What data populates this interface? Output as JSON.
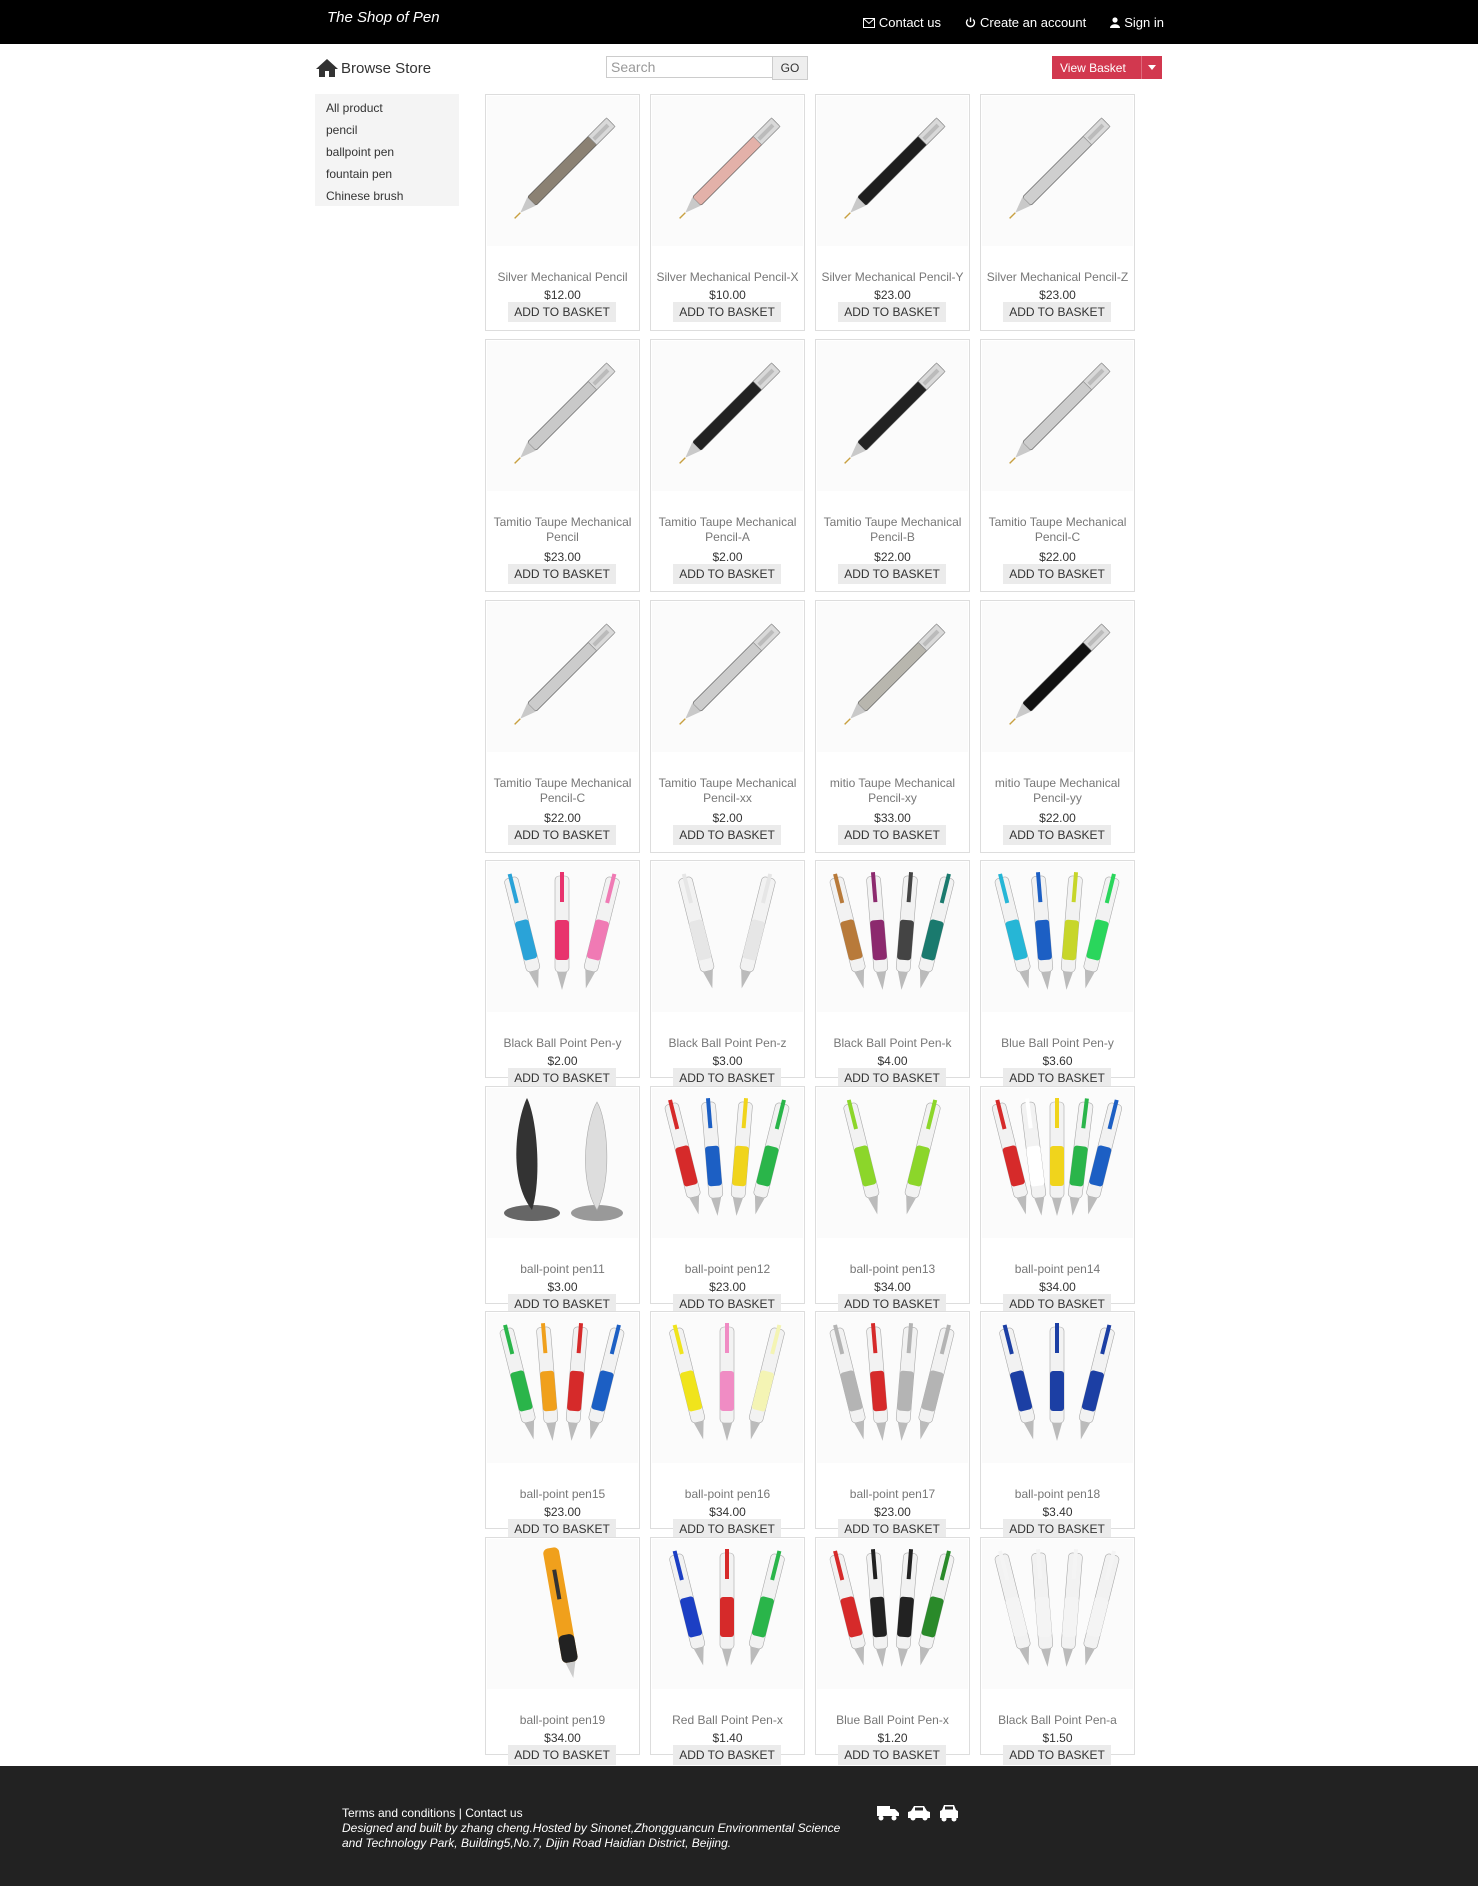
{
  "header": {
    "brand": "The Shop of Pen",
    "contact_label": "Contact us",
    "create_account_label": "Create an account",
    "signin_label": "Sign in"
  },
  "toolbar": {
    "browse_label": "Browse Store",
    "search_placeholder": "Search",
    "go_label": "GO",
    "basket_label": "View Basket",
    "basket_color": "#d2384f"
  },
  "sidebar": {
    "items": [
      {
        "label": "All product"
      },
      {
        "label": "pencil"
      },
      {
        "label": "ballpoint pen"
      },
      {
        "label": "fountain pen"
      },
      {
        "label": "Chinese brush"
      }
    ]
  },
  "products": [
    {
      "name": "Silver Mechanical Pencil",
      "price": "$12.00",
      "style": "pencil",
      "color": "#8b8173"
    },
    {
      "name": "Silver Mechanical Pencil-X",
      "price": "$10.00",
      "style": "pencil",
      "color": "#e3b1a9"
    },
    {
      "name": "Silver Mechanical Pencil-Y",
      "price": "$23.00",
      "style": "pencil",
      "color": "#1e1e1e"
    },
    {
      "name": "Silver Mechanical Pencil-Z",
      "price": "$23.00",
      "style": "pencil",
      "color": "#cfcfcf"
    },
    {
      "name": "Tamitio Taupe Mechanical Pencil",
      "price": "$23.00",
      "style": "pencil",
      "color": "#c9c9c9"
    },
    {
      "name": "Tamitio Taupe Mechanical Pencil-A",
      "price": "$2.00",
      "style": "pencil",
      "color": "#222222"
    },
    {
      "name": "Tamitio Taupe Mechanical Pencil-B",
      "price": "$22.00",
      "style": "pencil",
      "color": "#222222"
    },
    {
      "name": "Tamitio Taupe Mechanical Pencil-C",
      "price": "$22.00",
      "style": "pencil",
      "color": "#cccccc"
    },
    {
      "name": "Tamitio Taupe Mechanical Pencil-C",
      "price": "$22.00",
      "style": "pencil",
      "color": "#cccccc"
    },
    {
      "name": "Tamitio Taupe Mechanical Pencil-xx",
      "price": "$2.00",
      "style": "pencil",
      "color": "#cccccc"
    },
    {
      "name": "mitio Taupe Mechanical Pencil-xy",
      "price": "$33.00",
      "style": "pencil",
      "color": "#b8b6ae"
    },
    {
      "name": "mitio Taupe Mechanical Pencil-yy",
      "price": "$22.00",
      "style": "pencil",
      "color": "#111111"
    },
    {
      "name": "Black Ball Point Pen-y",
      "price": "$2.00",
      "style": "multi",
      "colors": [
        "#2aa3d8",
        "#e8336d",
        "#f07ab4"
      ]
    },
    {
      "name": "Black Ball Point Pen-z",
      "price": "$3.00",
      "style": "multi",
      "colors": [
        "#e6e6e6",
        "#e6e6e6"
      ]
    },
    {
      "name": "Black Ball Point Pen-k",
      "price": "$4.00",
      "style": "multi",
      "colors": [
        "#b87a3a",
        "#8c2a6e",
        "#444444",
        "#1a7a6e"
      ]
    },
    {
      "name": "Blue Ball Point Pen-y",
      "price": "$3.60",
      "style": "multi",
      "colors": [
        "#26b6d6",
        "#1c5fc4",
        "#c7d62a",
        "#2ad65c"
      ]
    },
    {
      "name": "ball-point pen11",
      "price": "$3.00",
      "style": "stand",
      "colors": [
        "#333333",
        "#dddddd"
      ]
    },
    {
      "name": "ball-point pen12",
      "price": "$23.00",
      "style": "multi",
      "colors": [
        "#d62a2a",
        "#1c5fc4",
        "#f0d41c",
        "#2ab54a"
      ]
    },
    {
      "name": "ball-point pen13",
      "price": "$34.00",
      "style": "multi",
      "colors": [
        "#8cd62a",
        "#8cd62a"
      ]
    },
    {
      "name": "ball-point pen14",
      "price": "$34.00",
      "style": "multi",
      "colors": [
        "#d62a2a",
        "#ffffff",
        "#f0d41c",
        "#2ab54a",
        "#1c5fc4"
      ]
    },
    {
      "name": "ball-point pen15",
      "price": "$23.00",
      "style": "multi",
      "colors": [
        "#2ab54a",
        "#f0a01c",
        "#d62a2a",
        "#1c5fc4"
      ]
    },
    {
      "name": "ball-point pen16",
      "price": "$34.00",
      "style": "multi",
      "colors": [
        "#f0e41c",
        "#f08cc4",
        "#f4f4b4"
      ]
    },
    {
      "name": "ball-point pen17",
      "price": "$23.00",
      "style": "multi",
      "colors": [
        "#b4b4b4",
        "#d62a2a",
        "#b4b4b4",
        "#b4b4b4"
      ]
    },
    {
      "name": "ball-point pen18",
      "price": "$3.40",
      "style": "multi",
      "colors": [
        "#1c3fa4",
        "#1c3fa4",
        "#1c3fa4"
      ]
    },
    {
      "name": "ball-point pen19",
      "price": "$34.00",
      "style": "single",
      "colors": [
        "#f0a01c"
      ]
    },
    {
      "name": "Red Ball Point Pen-x",
      "price": "$1.40",
      "style": "multi",
      "colors": [
        "#1c3fc4",
        "#d62a2a",
        "#2ab54a"
      ]
    },
    {
      "name": "Blue Ball Point Pen-x",
      "price": "$1.20",
      "style": "multi",
      "colors": [
        "#d62a2a",
        "#222222",
        "#222222",
        "#2a8a2a"
      ]
    },
    {
      "name": "Black Ball Point Pen-a",
      "price": "$1.50",
      "style": "multi",
      "colors": [
        "#f4f4f4",
        "#f4f4f4",
        "#f4f4f4",
        "#f4f4f4"
      ]
    }
  ],
  "product_button_label": "ADD TO BASKET",
  "footer": {
    "terms_label": "Terms and conditions",
    "separator": "|",
    "contact_label": "Contact us",
    "credit": "Designed and built by zhang cheng.Hosted by Sinonet,Zhongguancun Environmental Science and Technology Park, Building5,No.7, Dijin Road Haidian District, Beijing."
  }
}
